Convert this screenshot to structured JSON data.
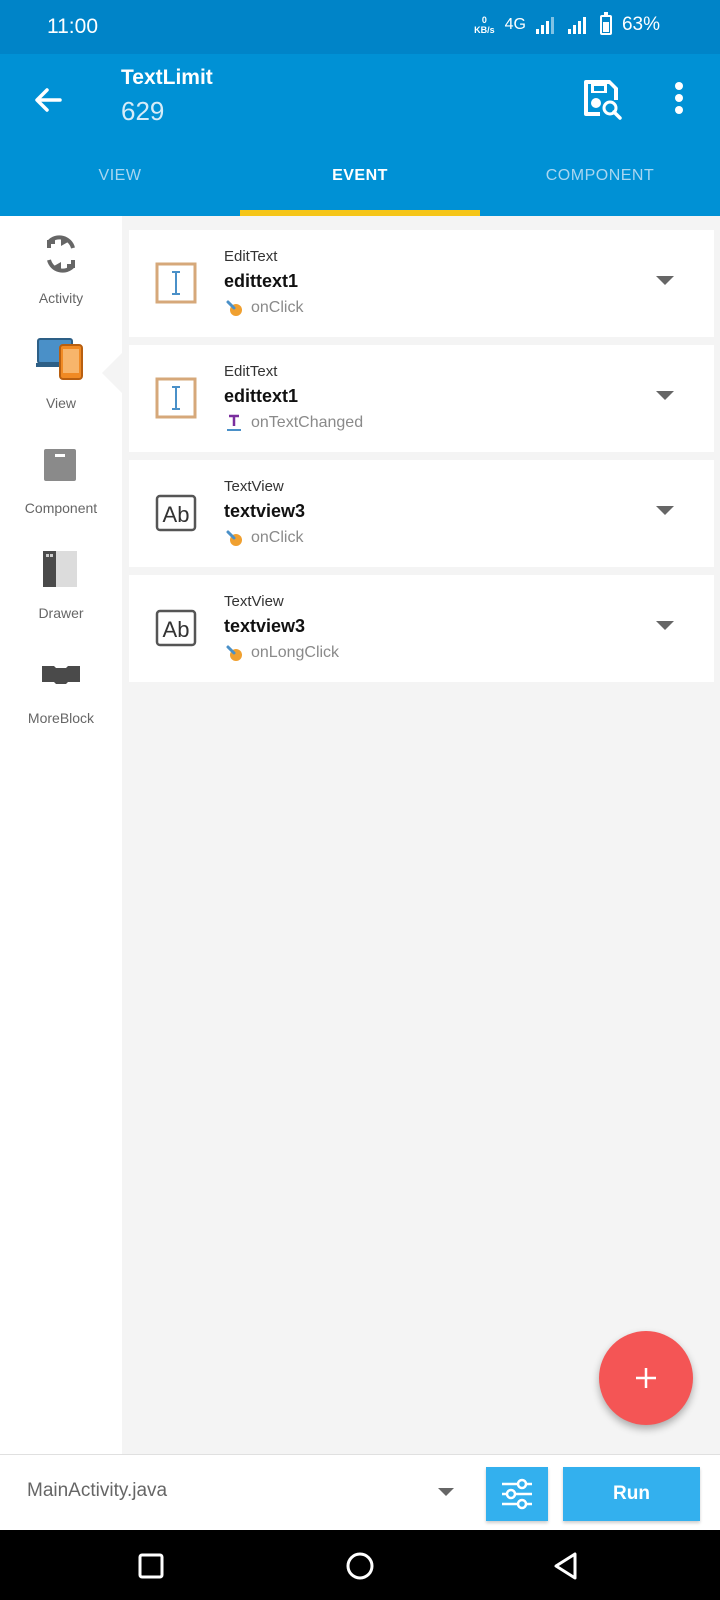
{
  "status_bar": {
    "time": "11:00",
    "net_speed_value": "0",
    "net_speed_unit": "KB/s",
    "network": "4G",
    "battery": "63%"
  },
  "app_bar": {
    "title": "TextLimit",
    "subtitle": "629",
    "icons": {
      "back": "arrow-left",
      "save": "save-icon",
      "more": "more-vert"
    }
  },
  "tabs": [
    {
      "label": "VIEW",
      "active": false
    },
    {
      "label": "EVENT",
      "active": true
    },
    {
      "label": "COMPONENT",
      "active": false
    }
  ],
  "sidebar": {
    "items": [
      {
        "label": "Activity",
        "icon": "refresh-icon"
      },
      {
        "label": "View",
        "icon": "devices-icon",
        "selected": true
      },
      {
        "label": "Component",
        "icon": "box-icon"
      },
      {
        "label": "Drawer",
        "icon": "drawer-icon"
      },
      {
        "label": "MoreBlock",
        "icon": "block-icon"
      }
    ]
  },
  "events": [
    {
      "type": "EditText",
      "name": "edittext1",
      "event": "onClick",
      "widget_icon": "edittext-icon",
      "event_icon": "touch-icon"
    },
    {
      "type": "EditText",
      "name": "edittext1",
      "event": "onTextChanged",
      "widget_icon": "edittext-icon",
      "event_icon": "text-change-icon"
    },
    {
      "type": "TextView",
      "name": "textview3",
      "event": "onClick",
      "widget_icon": "textview-icon",
      "event_icon": "touch-icon"
    },
    {
      "type": "TextView",
      "name": "textview3",
      "event": "onLongClick",
      "widget_icon": "textview-icon",
      "event_icon": "touch-icon"
    }
  ],
  "fab": {
    "icon": "plus-icon"
  },
  "bottom_bar": {
    "file": "MainActivity.java",
    "run_label": "Run"
  },
  "colors": {
    "status_bar": "#0084c8",
    "app_bar": "#0091d5",
    "tab_indicator": "#f5c518",
    "fab": "#f45555",
    "button": "#33b0ee"
  }
}
